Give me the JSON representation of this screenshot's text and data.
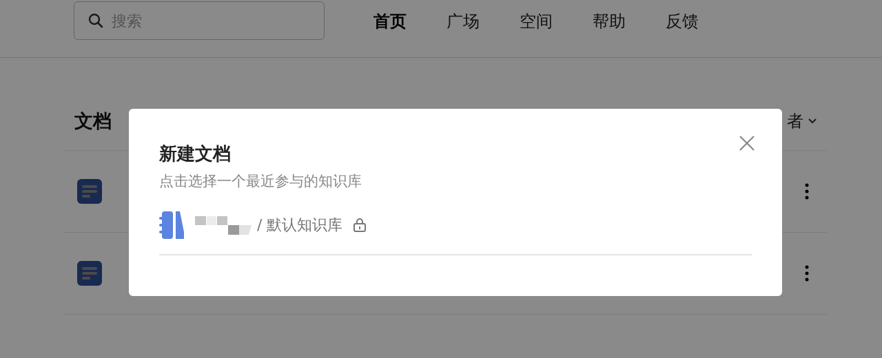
{
  "search": {
    "placeholder": "搜索"
  },
  "nav": [
    {
      "label": "首页",
      "selected": true
    },
    {
      "label": "广场",
      "selected": false
    },
    {
      "label": "空间",
      "selected": false
    },
    {
      "label": "帮助",
      "selected": false
    },
    {
      "label": "反馈",
      "selected": false
    }
  ],
  "list_header": {
    "tab": "文档",
    "sort_label": "者"
  },
  "rows": [
    {
      "kind": "doc"
    },
    {
      "kind": "doc"
    }
  ],
  "dialog": {
    "title": "新建文档",
    "subtitle": "点击选择一个最近参与的知识库",
    "repos": [
      {
        "path": "/ 默认知识库",
        "locked": true
      }
    ]
  }
}
